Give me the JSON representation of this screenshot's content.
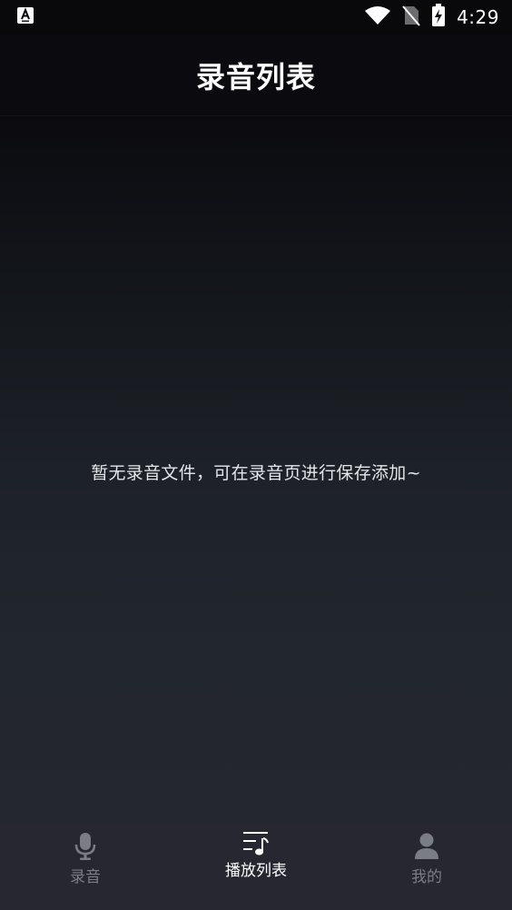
{
  "status_bar": {
    "time": "4:29",
    "notification_icon": "a-keyboard-icon",
    "wifi_icon": "wifi-icon",
    "sim_icon": "no-sim-icon",
    "battery_icon": "battery-charging-icon"
  },
  "header": {
    "title": "录音列表"
  },
  "main": {
    "empty_message": "暂无录音文件，可在录音页进行保存添加~"
  },
  "bottom_nav": {
    "items": [
      {
        "label": "录音",
        "icon": "microphone-icon",
        "active": false
      },
      {
        "label": "播放列表",
        "icon": "playlist-music-icon",
        "active": true
      },
      {
        "label": "我的",
        "icon": "person-icon",
        "active": false
      }
    ]
  },
  "colors": {
    "background_top": "#0a0a0e",
    "background_bottom": "#262731",
    "active": "#ffffff",
    "inactive": "#7a7d86"
  }
}
